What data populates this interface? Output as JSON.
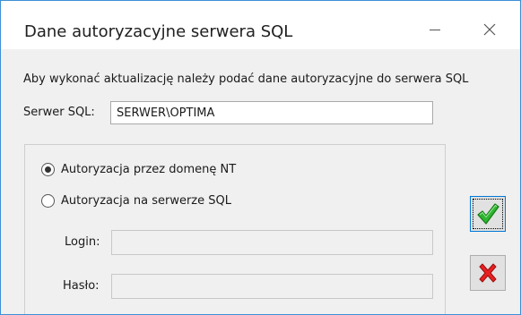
{
  "window": {
    "title": "Dane autoryzacyjne serwera SQL",
    "minimize_icon": "minimize-icon",
    "close_icon": "close-icon"
  },
  "description": "Aby wykonać aktualizację należy podać dane autoryzacyjne do serwera SQL",
  "server": {
    "label": "Serwer SQL:",
    "value": "SERWER\\OPTIMA"
  },
  "auth": {
    "options": [
      {
        "label": "Autoryzacja przez domenę NT",
        "selected": true
      },
      {
        "label": "Autoryzacja na serwerze SQL",
        "selected": false
      }
    ],
    "login_label": "Login:",
    "login_value": "",
    "password_label": "Hasło:",
    "password_value": ""
  },
  "buttons": {
    "ok_icon": "green-checkmark-icon",
    "cancel_icon": "red-x-icon"
  },
  "colors": {
    "accent_border": "#3c8fd6",
    "ok_green": "#1e9e1e",
    "cancel_red": "#e11b1b"
  }
}
